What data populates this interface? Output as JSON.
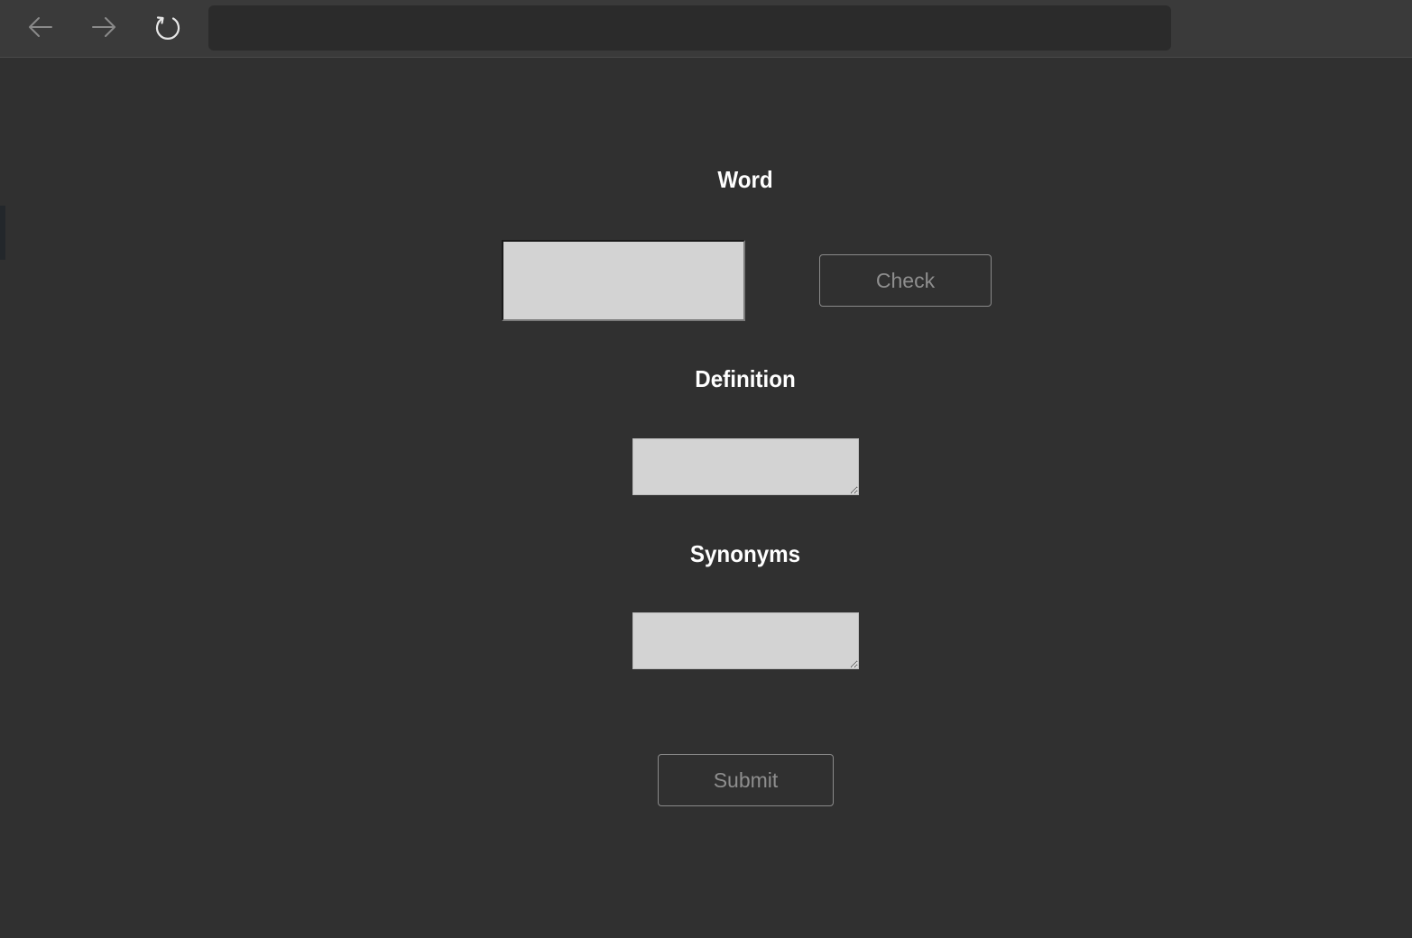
{
  "browser": {
    "address_value": "",
    "icons": {
      "back": "arrow-left-icon",
      "forward": "arrow-right-icon",
      "reload": "reload-icon"
    }
  },
  "form": {
    "word_label": "Word",
    "word_value": "",
    "check_label": "Check",
    "definition_label": "Definition",
    "definition_value": "",
    "synonyms_label": "Synonyms",
    "synonyms_value": "",
    "submit_label": "Submit"
  },
  "colors": {
    "page_background": "#303030",
    "toolbar_background": "#3a3a3a",
    "address_bar": "#2b2b2b",
    "field_background": "#d3d3d3",
    "label_text": "#ffffff",
    "button_text": "#8e8e8e",
    "button_border": "#8a8a8a"
  }
}
